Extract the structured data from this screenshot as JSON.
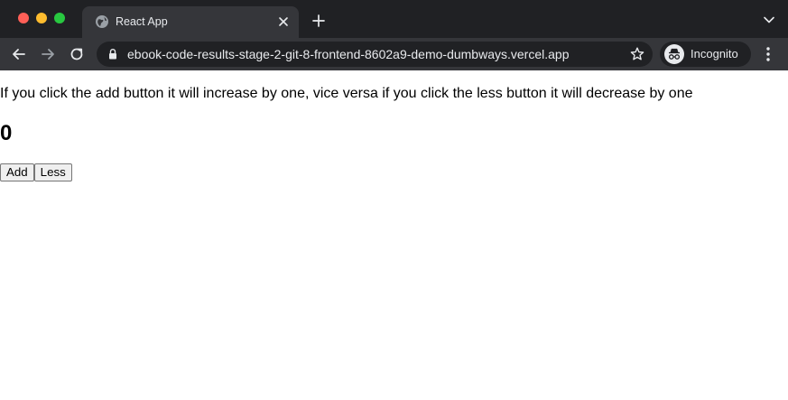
{
  "browser": {
    "tab": {
      "title": "React App",
      "favicon": "globe-icon"
    },
    "address_bar": {
      "url": "ebook-code-results-stage-2-git-8-frontend-8602a9-demo-dumbways.vercel.app"
    },
    "profile": {
      "label": "Incognito"
    },
    "colors": {
      "frame": "#202124",
      "toolbar": "#35363a",
      "text": "#e8eaed",
      "close": "#ff5f57",
      "minimize": "#febc2e",
      "maximize": "#28c840"
    }
  },
  "page": {
    "description": "If you click the add button it will increase by one, vice versa if you click the less button it will decrease by one",
    "count": "0",
    "buttons": {
      "add_label": "Add",
      "less_label": "Less"
    }
  }
}
